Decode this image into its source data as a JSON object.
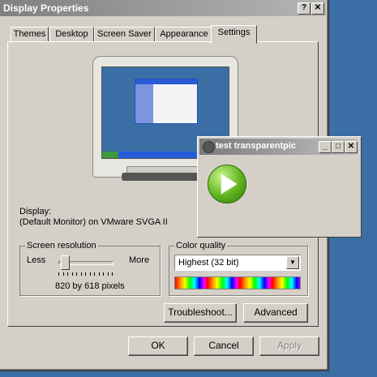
{
  "window": {
    "title": "Display Properties",
    "help_btn": "?",
    "close_btn": "✕"
  },
  "tabs": [
    "Themes",
    "Desktop",
    "Screen Saver",
    "Appearance",
    "Settings"
  ],
  "active_tab": "Settings",
  "display": {
    "label": "Display:",
    "value": "(Default Monitor) on VMware SVGA II"
  },
  "resolution": {
    "title": "Screen resolution",
    "less": "Less",
    "more": "More",
    "value": "820 by 618 pixels",
    "slider_level": 0.1
  },
  "color_quality": {
    "title": "Color quality",
    "selected": "Highest (32 bit)"
  },
  "buttons": {
    "troubleshoot": "Troubleshoot...",
    "advanced": "Advanced",
    "ok": "OK",
    "cancel": "Cancel",
    "apply": "Apply"
  },
  "popup": {
    "title": "test transparentpic",
    "min": "_",
    "max": "□",
    "close": "✕"
  }
}
